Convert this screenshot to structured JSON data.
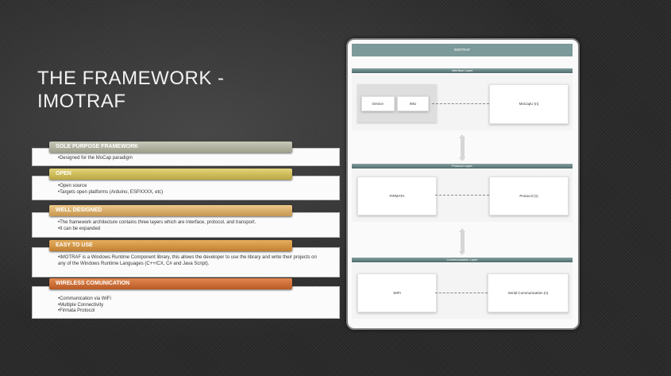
{
  "slide": {
    "title_line1": "THE FRAMEWORK -",
    "title_line2": "IMOTRAF"
  },
  "sections": [
    {
      "header": "SOLE PURPOSE FRAMEWORK",
      "color": "#b3b3a2",
      "bullets": [
        "•Designed for the MoCap paradigm"
      ]
    },
    {
      "header": "OPEN",
      "color": "#d2c15c",
      "bullets": [
        "•Open source",
        "•Targets open platforms (Arduino, ESPXXXX, etc)"
      ]
    },
    {
      "header": "WELL DESIGNED",
      "color": "#dcb06e",
      "bullets": [
        "•The framework architecture contains three layers which are interface, protocol, and transport.",
        "•It can be expanded"
      ]
    },
    {
      "header": "EASY TO USE",
      "color": "#d49848",
      "bullets": [
        "•IMOTRAF is a Windows Runtime Component library, this allows the developer to use the library and write their projects on any of the Windows Runtime Languages (C++/CX, C# and Java Script)."
      ]
    },
    {
      "header": "WIRELESS COMUNICATION",
      "color": "#cd6f38",
      "bullets": [
        "•Communication via WiFi",
        "•Multiple Connectivity",
        "•Firmata Protocol"
      ]
    }
  ],
  "diagram": {
    "title": "IMOTRAF",
    "interface_layer": {
      "label": "Interface Layer",
      "device": "Device",
      "imu": "IMU",
      "mocap": "MoCapU (n)"
    },
    "protocol_layer": {
      "label": "Protocol Layer",
      "firmata": "FIRMATA",
      "protocol": "Protocol (n)"
    },
    "communication_layer": {
      "label": "Communication Layer",
      "wifi": "WIFI",
      "serial": "Serial Communication (n)"
    }
  }
}
